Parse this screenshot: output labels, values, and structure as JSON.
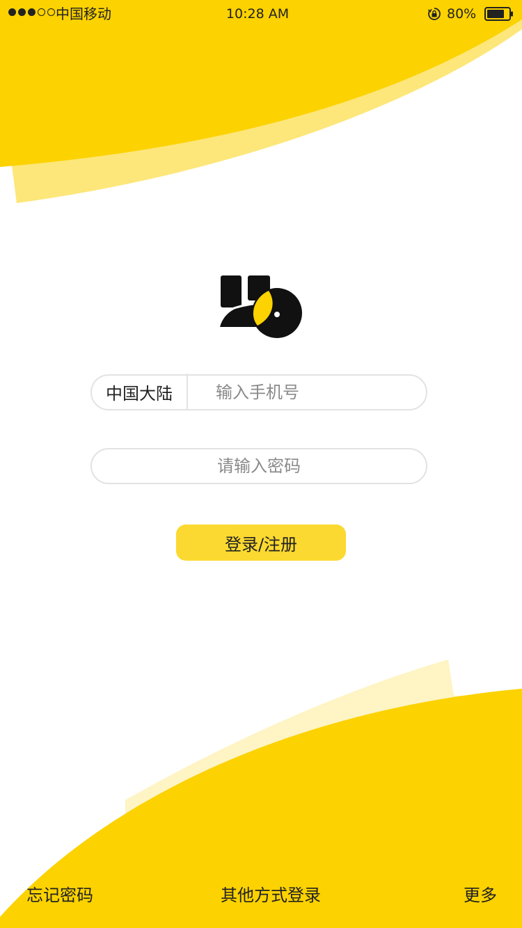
{
  "status_bar": {
    "carrier": "中国移动",
    "time": "10:28 AM",
    "battery_percent": "80%",
    "battery_level": 0.8,
    "signal_bars_filled": 3,
    "signal_bars_total": 5
  },
  "theme": {
    "accent": "#FCD200",
    "accent_light": "#FDE77A",
    "accent_pale": "#FEF4C4",
    "button": "#FCD930"
  },
  "form": {
    "region_label": "中国大陆",
    "phone_placeholder": "输入手机号",
    "password_placeholder": "请输入密码",
    "login_label": "登录/注册"
  },
  "footer": {
    "forgot_password": "忘记密码",
    "other_login": "其他方式登录",
    "more": "更多"
  }
}
